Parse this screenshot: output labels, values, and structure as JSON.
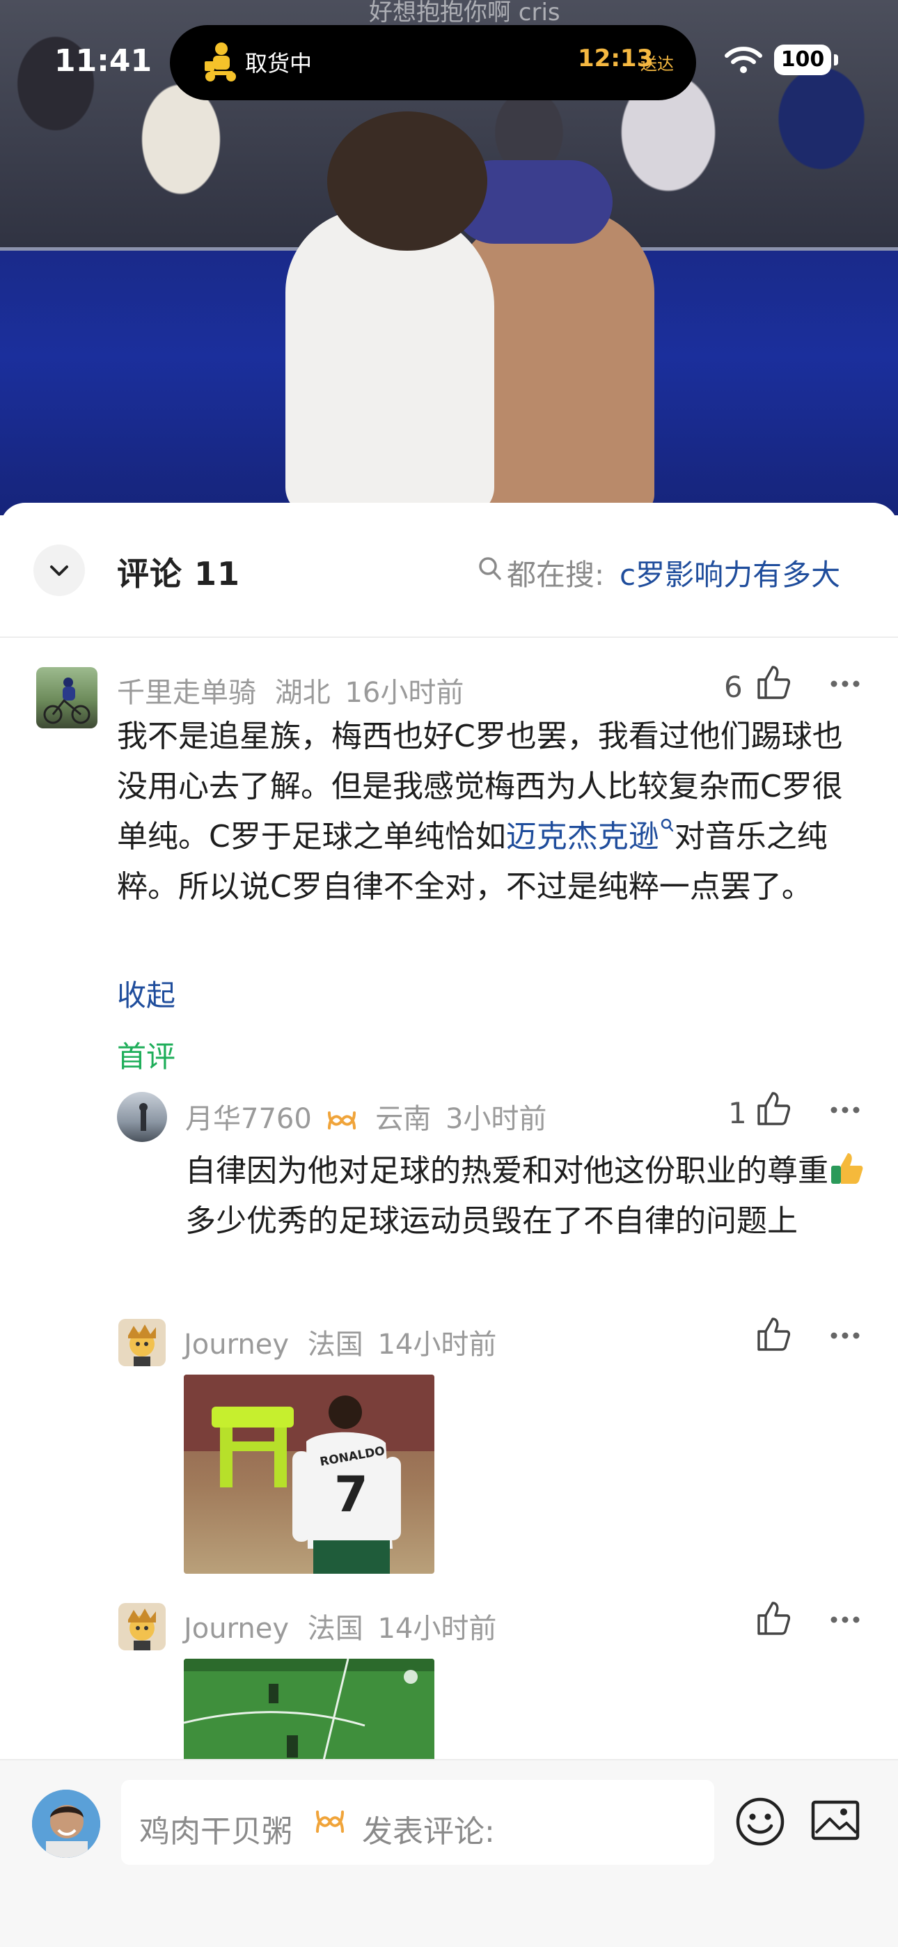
{
  "status_bar": {
    "time": "11:41",
    "island_status": "取货中",
    "island_eta_time": "12:13",
    "island_eta_suffix": "送达",
    "battery": "100"
  },
  "video": {
    "caption_fragment": "好想抱抱你啊 cris"
  },
  "sheet": {
    "title": "评论 11",
    "search_prefix": "都在搜:",
    "search_query": "c罗影响力有多大"
  },
  "comments": [
    {
      "user": "千里走单骑",
      "location": "湖北",
      "time": "16小时前",
      "likes": "6",
      "text_before_link": "我不是追星族，梅西也好C罗也罢，我看过他们踢球也没用心去了解。但是我感觉梅西为人比较复杂而C罗很单纯。C罗于足球之单纯恰如",
      "link": "迈克杰克逊",
      "text_after_link": "对音乐之纯粹。所以说C罗自律不全对，不过是纯粹一点罢了。",
      "collapse_label": "收起",
      "badge": "首评"
    }
  ],
  "replies": [
    {
      "user": "月华7760",
      "location": "云南",
      "time": "3小时前",
      "likes": "1",
      "text_part1": "自律因为他对足球的热爱和对他这份职业的尊重",
      "text_part2": "多少优秀的足球运动员毁在了不自律的问题上"
    },
    {
      "user": "Journey",
      "location": "法国",
      "time": "14小时前",
      "likes": "",
      "jersey_name": "RONALDO",
      "jersey_number": "7"
    },
    {
      "user": "Journey",
      "location": "法国",
      "time": "14小时前",
      "likes": ""
    }
  ],
  "input_bar": {
    "username": "鸡肉干贝粥",
    "placeholder": "发表评论:"
  },
  "colors": {
    "link": "#1f4d9c",
    "first_comment_badge": "#1fae5a",
    "island_eta": "#f5b841",
    "vip_badge": "#f0a43a"
  }
}
